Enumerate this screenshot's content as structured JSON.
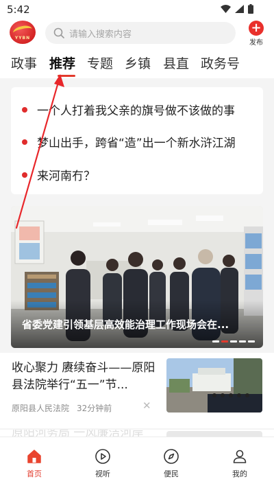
{
  "status_bar": {
    "time": "5:42",
    "icons": [
      "wifi-icon",
      "signal-icon",
      "battery-icon"
    ]
  },
  "header": {
    "logo_text": "YYBN",
    "search_placeholder": "请输入搜索内容",
    "publish_label": "发布"
  },
  "tabs": [
    {
      "label": "政事",
      "active": false
    },
    {
      "label": "推荐",
      "active": true
    },
    {
      "label": "专题",
      "active": false
    },
    {
      "label": "乡镇",
      "active": false
    },
    {
      "label": "县直",
      "active": false
    },
    {
      "label": "政务号",
      "active": false
    }
  ],
  "headlines": [
    {
      "text": "一个人打着我父亲的旗号做不该做的事"
    },
    {
      "text": "梦山出手，跨省“造”出一个新水浒江湖"
    },
    {
      "text": "来河南冇？"
    }
  ],
  "banner": {
    "caption": "省委党建引领基层高效能治理工作现场会在...",
    "slide_count": 5,
    "active_slide": 2
  },
  "news_list": [
    {
      "title": "收心聚力 赓续奋斗——原阳县法院举行“五一”节...",
      "source": "原阳县人民法院",
      "time": "32分钟前"
    },
    {
      "title": "原阳河务局 一风廉洁河岸"
    }
  ],
  "bottom_nav": [
    {
      "label": "首页",
      "icon": "home-icon",
      "active": true
    },
    {
      "label": "视听",
      "icon": "play-icon",
      "active": false
    },
    {
      "label": "便民",
      "icon": "compass-icon",
      "active": false
    },
    {
      "label": "我的",
      "icon": "user-icon",
      "active": false
    }
  ],
  "colors": {
    "accent": "#e23a2c",
    "annotation_arrow": "#e8262a"
  }
}
